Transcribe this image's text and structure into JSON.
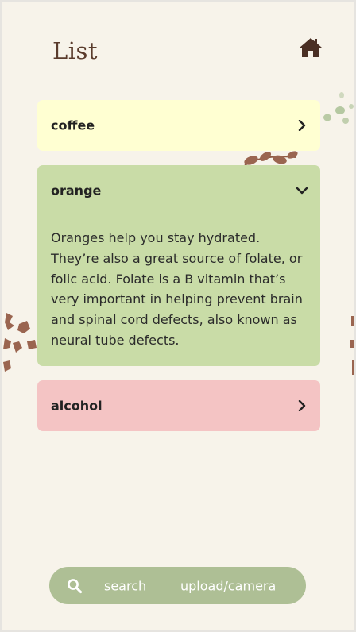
{
  "header": {
    "title": "List",
    "home_icon": "home-icon"
  },
  "list": {
    "items": [
      {
        "label": "coffee",
        "expanded": false,
        "color": "#ffffd2",
        "icon": "chevron-right-icon"
      },
      {
        "label": "orange",
        "expanded": true,
        "color": "#c9dca7",
        "icon": "chevron-down-icon",
        "description": "Oranges help you stay hydrated. They’re also a great source of folate, or folic acid. Folate is a B vitamin that’s very important in helping prevent brain and spinal cord defects, also known as neural tube defects."
      },
      {
        "label": "alcohol",
        "expanded": false,
        "color": "#f4c4c4",
        "icon": "chevron-right-icon"
      }
    ]
  },
  "bottom_bar": {
    "search_icon": "search-icon",
    "search_label": "search",
    "upload_label": "upload/camera",
    "color": "#aebf95"
  },
  "colors": {
    "background": "#f7f3ea",
    "title": "#5a3b2c",
    "leaf_brown": "#9a6550",
    "leaf_green": "#a9bf94"
  }
}
